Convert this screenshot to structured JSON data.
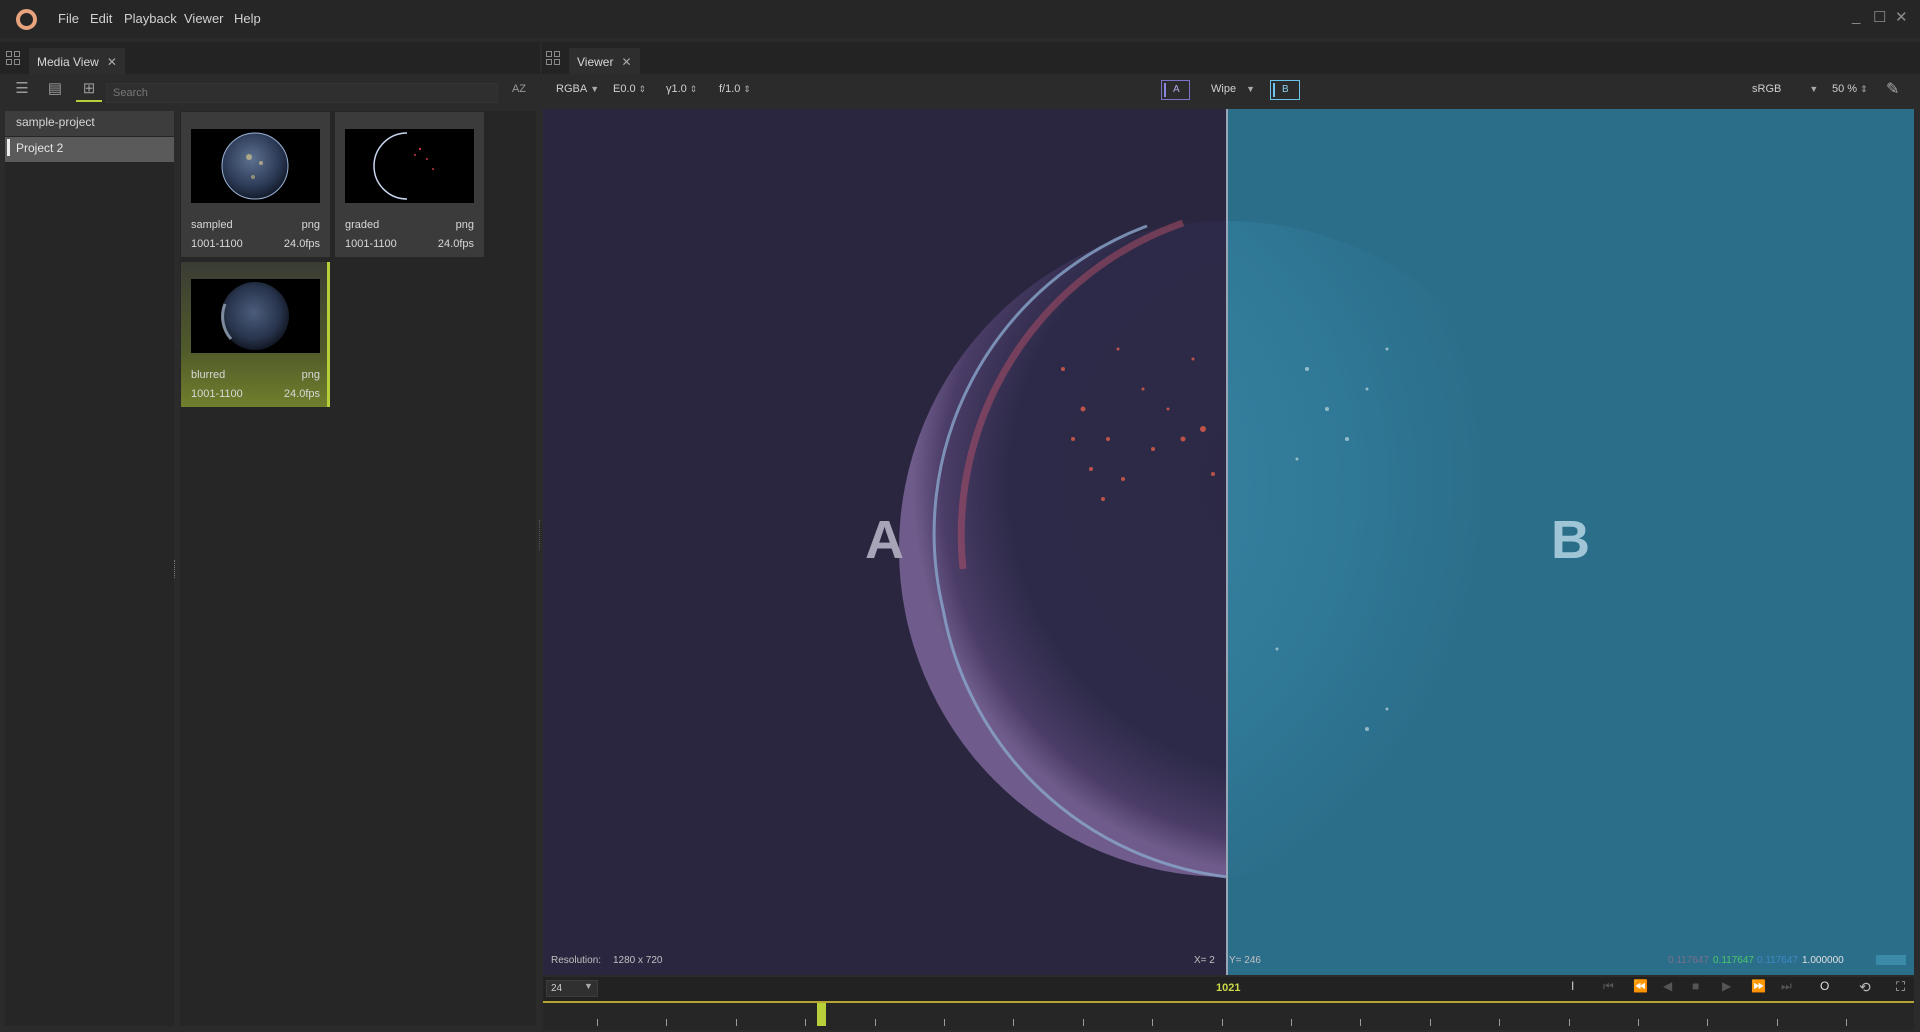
{
  "app": {
    "menu": [
      "File",
      "Edit",
      "Playback",
      "Viewer",
      "Help"
    ],
    "window_controls": [
      "_",
      "☐",
      "✕"
    ]
  },
  "media_panel": {
    "tab_label": "Media View",
    "search_placeholder": "Search",
    "sort_label": "AZ",
    "projects": [
      "sample-project",
      "Project 2"
    ],
    "selected_project": "Project 2",
    "media": [
      {
        "name": "sampled",
        "ext": "png",
        "range": "1001-1100",
        "fps": "24.0fps"
      },
      {
        "name": "graded",
        "ext": "png",
        "range": "1001-1100",
        "fps": "24.0fps"
      },
      {
        "name": "blurred",
        "ext": "png",
        "range": "1001-1100",
        "fps": "24.0fps",
        "selected": true
      }
    ]
  },
  "viewer": {
    "tab_label": "Viewer",
    "channels": "RGBA",
    "exposure": "E0.0",
    "gamma": "γ1.0",
    "fstop": "f/1.0",
    "compare_a": "A",
    "compare_mode": "Wipe",
    "compare_b": "B",
    "display": "sRGB",
    "zoom": "50 %",
    "overlay_a": "A",
    "overlay_b": "B",
    "resolution_label": "Resolution:",
    "resolution_value": "1280 x 720",
    "cursor_x": "X=  2",
    "cursor_y": "Y=  246",
    "pixel_r": "0.117647",
    "pixel_g": "0.117647",
    "pixel_b": "0.117647",
    "pixel_a": "1.000000"
  },
  "timeline": {
    "fps": "24",
    "current_frame": "1021",
    "loop_label": "O",
    "playhead_fraction": 0.2
  },
  "colors": {
    "accent": "#b9cf3a",
    "a_side": "#2a2640",
    "b_side": "#2b6e8a",
    "frame_number": "#cbd848"
  }
}
